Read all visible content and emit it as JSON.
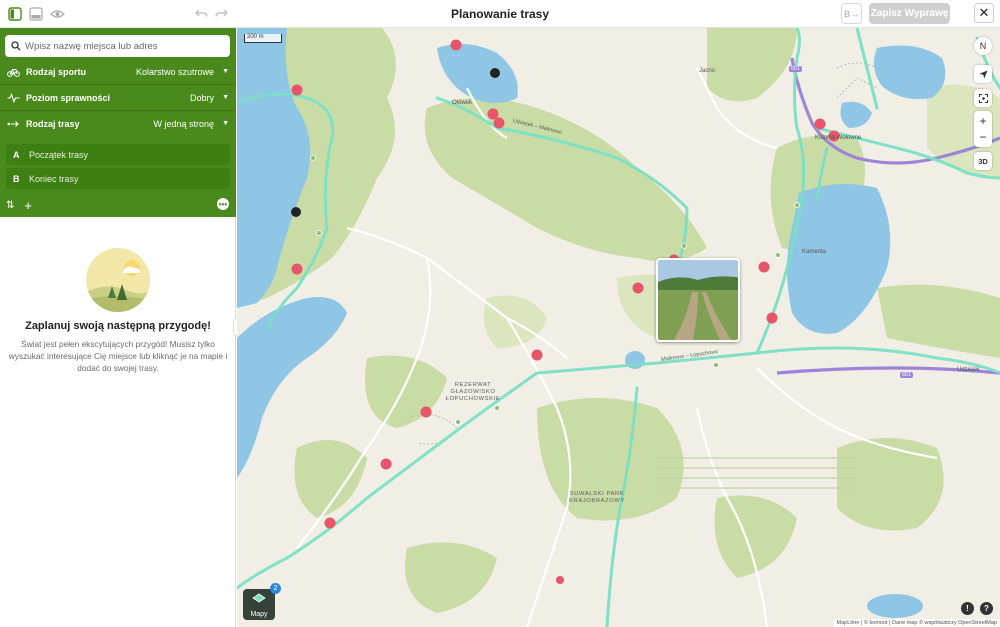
{
  "header": {
    "title": "Planowanie trasy",
    "save_label": "Zapisz Wyprawę",
    "gpx_label": "B→"
  },
  "sidebar": {
    "search_placeholder": "Wpisz nazwę miejsca lub adres",
    "options": [
      {
        "label": "Rodzaj sportu",
        "value": "Kolarstwo szutrowe",
        "icon": "gravel-bike-icon"
      },
      {
        "label": "Poziom sprawności",
        "value": "Dobry",
        "icon": "pulse-icon"
      },
      {
        "label": "Rodzaj trasy",
        "value": "W jedną stronę",
        "icon": "one-way-route-icon"
      }
    ],
    "waypoints": [
      {
        "letter": "A",
        "text": "Początek trasy"
      },
      {
        "letter": "B",
        "text": "Koniec trasy"
      }
    ],
    "empty_title": "Zaplanuj swoją następną przygodę!",
    "empty_text": "Świat jest pełen ekscytujących przygód! Musisz tylko wyszukać interesujące Cię miejsce lub kliknąć je na mapie i dodać do swojej trasy."
  },
  "map": {
    "scale": "200 m",
    "layers_label": "Mapy",
    "layers_badge": "2",
    "compass_label": "N",
    "zoom_in": "+",
    "zoom_out": "−",
    "mode_3d": "3D",
    "attribution": "MapLibre | © komoot | Dane map © współautorzy OpenStreetMap",
    "labels": {
      "jacno": "Jacno",
      "oszkinie": "Ołówek",
      "kolonia": "Kolonia Wołowne",
      "kamenta": "Kamenta",
      "udziejek": "Udziejek",
      "reserve": "REZERWAT GŁAZOWISKO\nŁOPUCHOWSKIE",
      "park": "SUWALSKI PARK\nKRAJOBRAZOWY",
      "road1": "Udziejek – Malinowo",
      "road2": "Malinowo – Łopuchowo",
      "road_num": "651"
    },
    "colors": {
      "water": "#8fc6e6",
      "forest": "#c9dba5",
      "route": "#79e0c4",
      "primary_road": "#9c85d8"
    }
  }
}
